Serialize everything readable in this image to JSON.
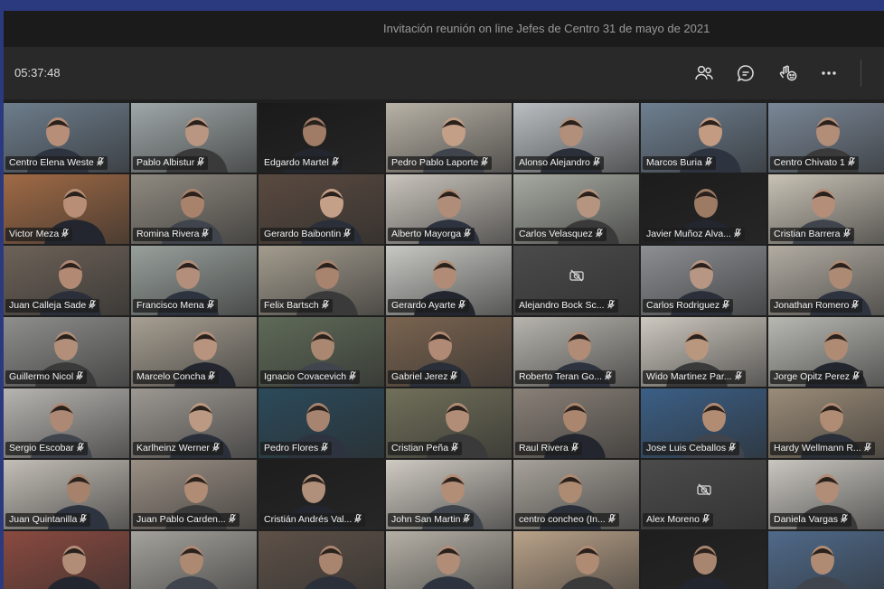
{
  "window": {
    "title": "Invitación reunión on line Jefes de Centro 31 de mayo de 2021"
  },
  "toolbar": {
    "timer": "05:37:48",
    "buttons": [
      {
        "name": "participants-icon"
      },
      {
        "name": "chat-icon"
      },
      {
        "name": "reactions-icon"
      },
      {
        "name": "more-options-icon"
      }
    ]
  },
  "participants": [
    {
      "name": "Centro Elena Weste",
      "bg": "#6d7d8c",
      "skin": "#b78f78",
      "camera": true
    },
    {
      "name": "Pablo Albistur",
      "bg": "#9fa7a8",
      "skin": "#b89682",
      "camera": true
    },
    {
      "name": "Edgardo Martel",
      "bg": "#1a1a1a",
      "skin": "#a07c66",
      "camera": true
    },
    {
      "name": "Pedro Pablo Laporte",
      "bg": "#b8b2a6",
      "skin": "#c29f86",
      "camera": true
    },
    {
      "name": "Alonso Alejandro",
      "bg": "#b9bec2",
      "skin": "#b18f7a",
      "camera": true
    },
    {
      "name": "Marcos Buria",
      "bg": "#6e7f90",
      "skin": "#c29b82",
      "camera": true
    },
    {
      "name": "Centro Chivato 1",
      "bg": "#7a8797",
      "skin": "#b28d78",
      "camera": true
    },
    {
      "name": "Victor Meza",
      "bg": "#a06a45",
      "skin": "#b88f76",
      "camera": true
    },
    {
      "name": "Romina Rivera",
      "bg": "#8f8a80",
      "skin": "#a9826b",
      "camera": true
    },
    {
      "name": "Gerardo Baibontin",
      "bg": "#5a4a40",
      "skin": "#c5a088",
      "camera": true
    },
    {
      "name": "Alberto Mayorga",
      "bg": "#c9c4bc",
      "skin": "#b08d78",
      "camera": true
    },
    {
      "name": "Carlos Velasquez",
      "bg": "#a7aaa2",
      "skin": "#b5957f",
      "camera": true
    },
    {
      "name": "Javier Muñoz Alva...",
      "bg": "#1c1c1c",
      "skin": "#9c7a64",
      "camera": true
    },
    {
      "name": "Cristian Barrera",
      "bg": "#c8c2b5",
      "skin": "#b48e79",
      "camera": true
    },
    {
      "name": "Juan Calleja Sade",
      "bg": "#6d6258",
      "skin": "#b28a74",
      "camera": true
    },
    {
      "name": "Francisco Mena",
      "bg": "#98a09c",
      "skin": "#b38f7b",
      "camera": true
    },
    {
      "name": "Felix Bartsch",
      "bg": "#a39c8e",
      "skin": "#a8836e",
      "camera": true
    },
    {
      "name": "Gerardo Ayarte",
      "bg": "#c7c7c3",
      "skin": "#b08c76",
      "camera": true
    },
    {
      "name": "Alejandro Bock Sc...",
      "bg": "#4b4b4b",
      "skin": "#000000",
      "camera": false
    },
    {
      "name": "Carlos Rodriguez",
      "bg": "#8c8f93",
      "skin": "#b79683",
      "camera": true
    },
    {
      "name": "Jonathan Romero",
      "bg": "#b2aca2",
      "skin": "#ad8a74",
      "camera": true
    },
    {
      "name": "Guillermo Nicol",
      "bg": "#8e8f8d",
      "skin": "#b38f7a",
      "camera": true
    },
    {
      "name": "Marcelo Concha",
      "bg": "#a79f92",
      "skin": "#b8937e",
      "camera": true
    },
    {
      "name": "Ignacio Covacevich",
      "bg": "#5f6a58",
      "skin": "#a98770",
      "camera": true
    },
    {
      "name": "Gabriel Jerez",
      "bg": "#7a6450",
      "skin": "#b08a74",
      "camera": true
    },
    {
      "name": "Roberto Teran Go...",
      "bg": "#b6b4ad",
      "skin": "#b08b76",
      "camera": true
    },
    {
      "name": "Wido Martinez Par...",
      "bg": "#cdc8bf",
      "skin": "#b9977f",
      "camera": true
    },
    {
      "name": "Jorge Opitz Perez",
      "bg": "#b8b8b3",
      "skin": "#b08b74",
      "camera": true
    },
    {
      "name": "Sergio Escobar",
      "bg": "#b7b5b1",
      "skin": "#ad8874",
      "camera": true
    },
    {
      "name": "Karlheinz Werner",
      "bg": "#9d9892",
      "skin": "#bb9982",
      "camera": true
    },
    {
      "name": "Pedro Flores",
      "bg": "#2b4a5a",
      "skin": "#a7846f",
      "camera": true
    },
    {
      "name": "Cristian Peña",
      "bg": "#71705a",
      "skin": "#b18c76",
      "camera": true
    },
    {
      "name": "Raul Rivera",
      "bg": "#8a8178",
      "skin": "#aa866f",
      "camera": true
    },
    {
      "name": "Jose Luis Ceballos",
      "bg": "#3b5f86",
      "skin": "#b28b73",
      "camera": true
    },
    {
      "name": "Hardy Wellmann R...",
      "bg": "#9b8c78",
      "skin": "#b08c75",
      "camera": true
    },
    {
      "name": "Juan Quintanilla",
      "bg": "#c3beb6",
      "skin": "#a6826d",
      "camera": true
    },
    {
      "name": "Juan Pablo Carden...",
      "bg": "#9a8f84",
      "skin": "#b18c75",
      "camera": true
    },
    {
      "name": "Cristián Andrés Val...",
      "bg": "#1d1d1d",
      "skin": "#b0907a",
      "camera": true
    },
    {
      "name": "John San Martin",
      "bg": "#cfcac2",
      "skin": "#b38e77",
      "camera": true
    },
    {
      "name": "centro concheo (In...",
      "bg": "#a7a29a",
      "skin": "#ad8a72",
      "camera": true
    },
    {
      "name": "Alex Moreno",
      "bg": "#4b4b4b",
      "skin": "#000000",
      "camera": false
    },
    {
      "name": "Daniela Vargas",
      "bg": "#c9c6c0",
      "skin": "#b18d77",
      "camera": true
    },
    {
      "name": "",
      "bg": "#8a4a40",
      "skin": "#b18c76",
      "camera": true
    },
    {
      "name": "",
      "bg": "#a4a29c",
      "skin": "#ad8972",
      "camera": true
    },
    {
      "name": "",
      "bg": "#5e5148",
      "skin": "#a9856f",
      "camera": true
    },
    {
      "name": "",
      "bg": "#b5b0a6",
      "skin": "#b18d77",
      "camera": true
    },
    {
      "name": "",
      "bg": "#b9a289",
      "skin": "#af8b74",
      "camera": true
    },
    {
      "name": "",
      "bg": "#1e1e1e",
      "skin": "#a7856f",
      "camera": true
    },
    {
      "name": "",
      "bg": "#4f6a8a",
      "skin": "#b08b74",
      "camera": true
    }
  ]
}
